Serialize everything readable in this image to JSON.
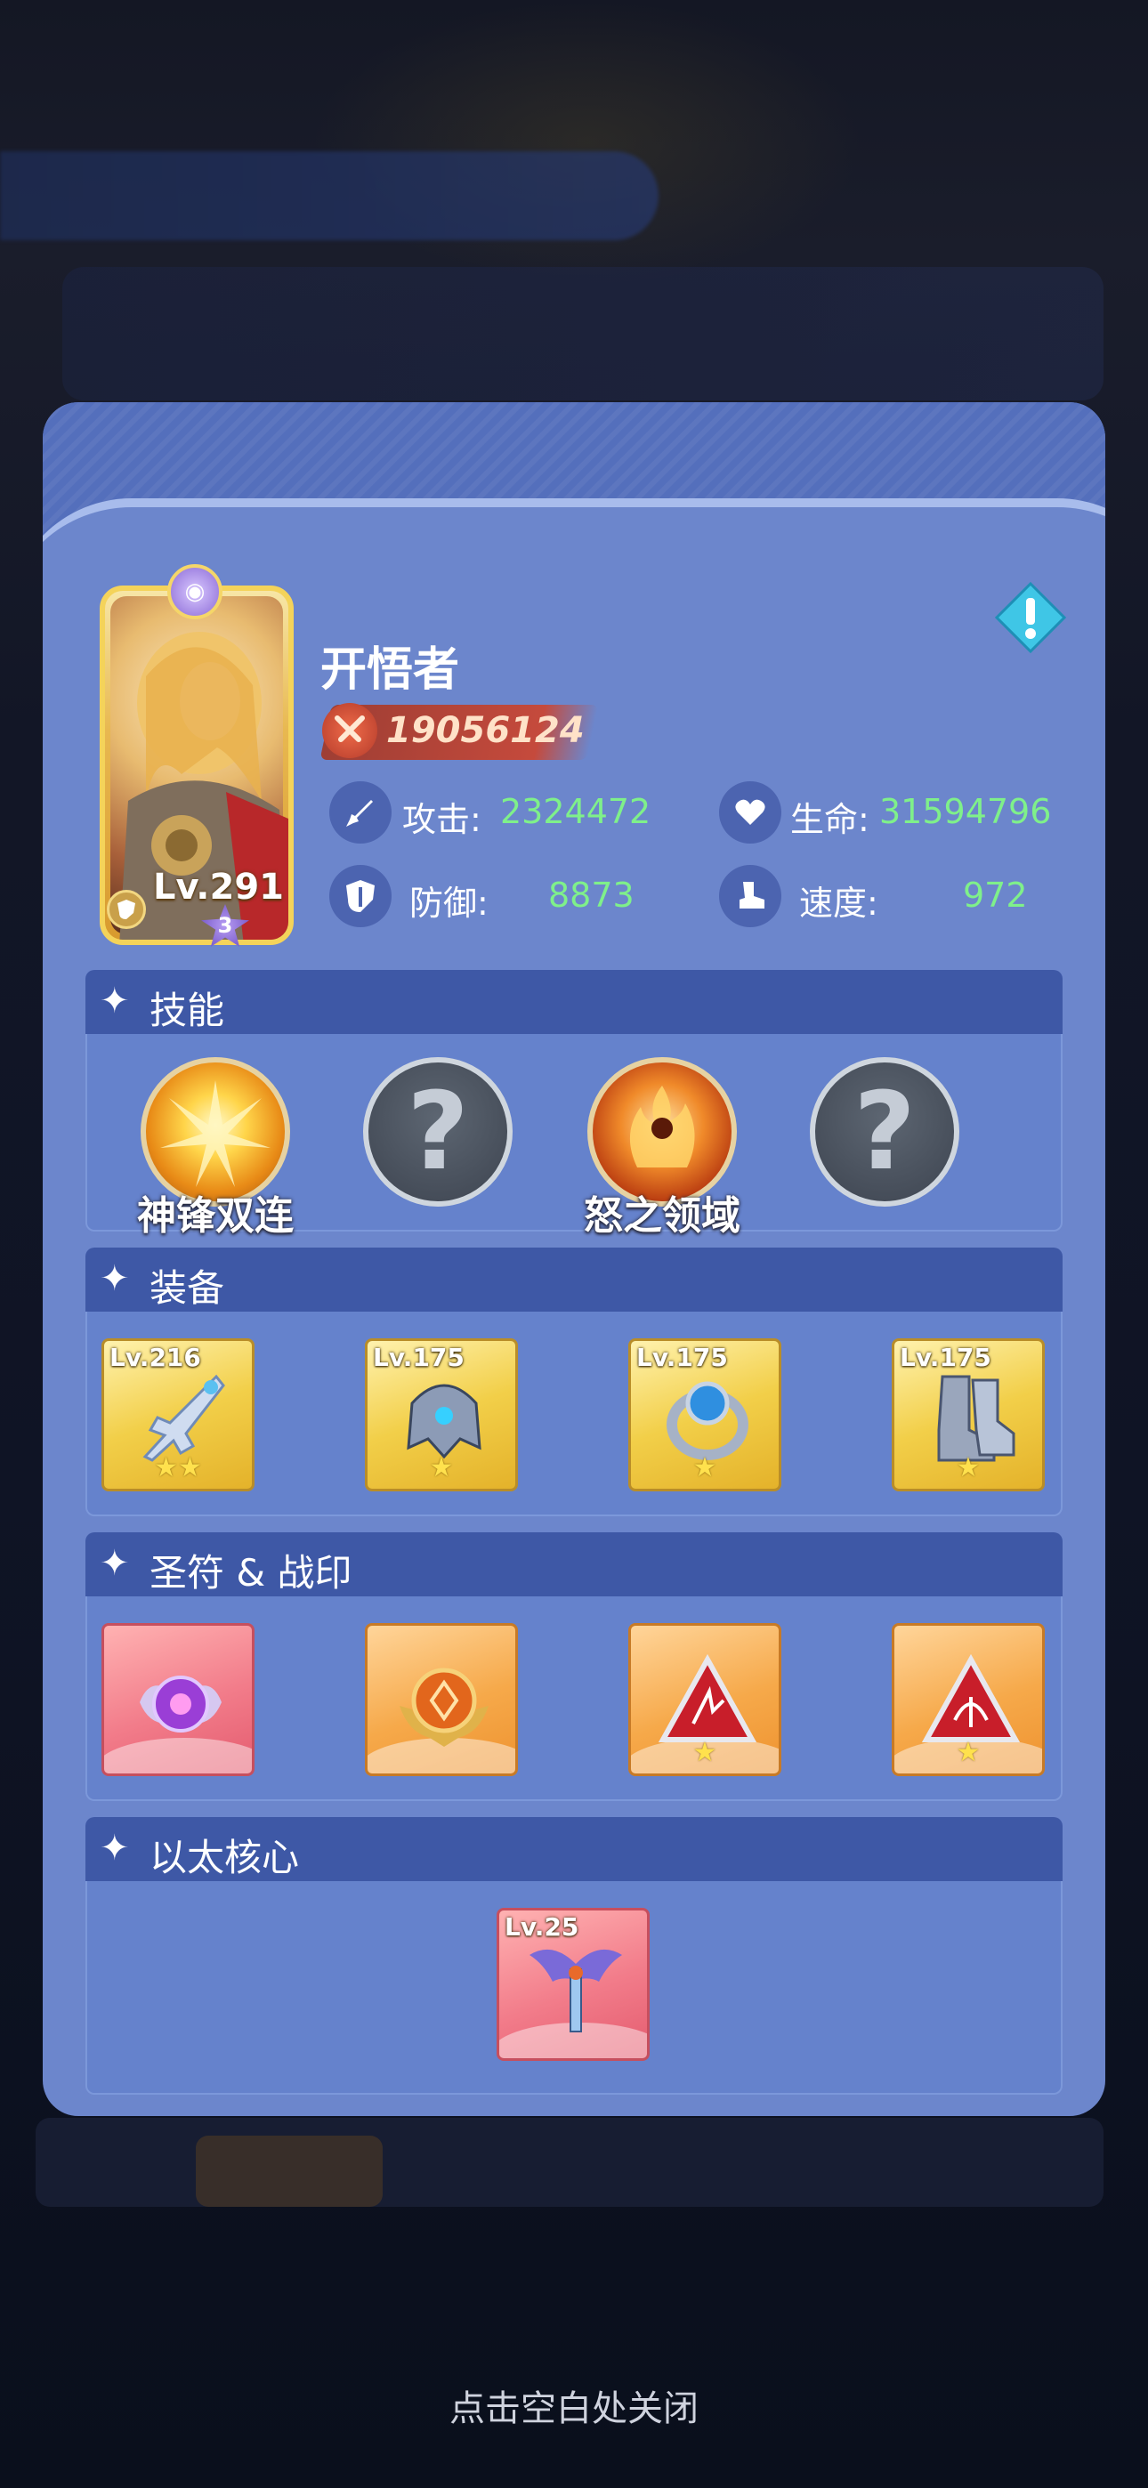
{
  "hero": {
    "name": "开悟者",
    "level_text": "Lv.291",
    "star_count": "3",
    "power": "19056124",
    "stats": {
      "attack_label": "攻击:",
      "attack_value": "2324472",
      "hp_label": "生命:",
      "hp_value": "31594796",
      "defense_label": "防御:",
      "defense_value": "8873",
      "speed_label": "速度:",
      "speed_value": "972"
    }
  },
  "sections": {
    "skills_title": "技能",
    "equipment_title": "装备",
    "runes_title": "圣符 & 战印",
    "core_title": "以太核心"
  },
  "skills": [
    {
      "name": "神锋双连",
      "locked": false,
      "icon": "golden-burst-icon"
    },
    {
      "name": "",
      "locked": true,
      "icon": "question-mark-icon",
      "glyph": "?"
    },
    {
      "name": "怒之领域",
      "locked": false,
      "icon": "flame-warrior-icon"
    },
    {
      "name": "",
      "locked": true,
      "icon": "question-mark-icon",
      "glyph": "?"
    }
  ],
  "equipment": [
    {
      "level": "Lv.216",
      "stars": "★★",
      "icon": "sword-icon"
    },
    {
      "level": "Lv.175",
      "stars": "★",
      "icon": "helmet-icon"
    },
    {
      "level": "Lv.175",
      "stars": "★",
      "icon": "ring-icon"
    },
    {
      "level": "Lv.175",
      "stars": "★",
      "icon": "boots-icon"
    }
  ],
  "runes": [
    {
      "stars": "",
      "icon": "purple-orb-rune-icon"
    },
    {
      "stars": "",
      "icon": "orange-emblem-rune-icon"
    },
    {
      "stars": "★",
      "icon": "red-triangle-seal-icon"
    },
    {
      "stars": "★",
      "icon": "red-triangle-seal-icon"
    }
  ],
  "core": {
    "level": "Lv.25",
    "icon": "winged-sword-core-icon"
  },
  "footer": {
    "close_hint": "点击空白处关闭"
  },
  "colors": {
    "panel": "#6c86cc",
    "section_header": "#3e58a6",
    "stat_value": "#7ff08a",
    "power_badge": "#c54a3c"
  }
}
